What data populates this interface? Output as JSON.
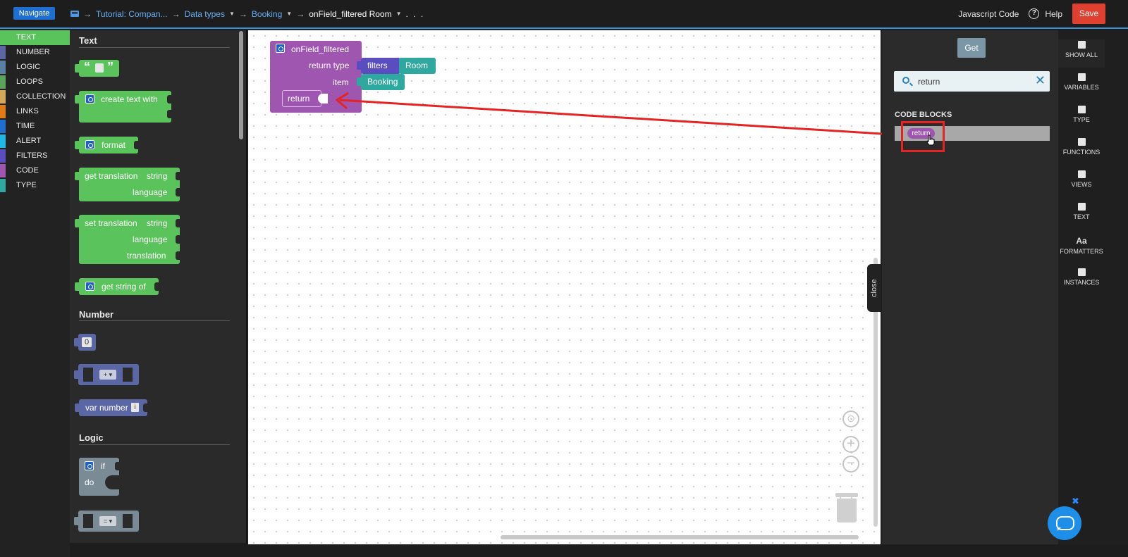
{
  "topbar": {
    "navigate_label": "Navigate",
    "breadcrumbs": [
      {
        "label": "Tutorial: Compan...",
        "dropdown": false
      },
      {
        "label": "Data types",
        "dropdown": true
      },
      {
        "label": "Booking",
        "dropdown": true
      },
      {
        "label": "onField_filtered Room",
        "dropdown": true
      }
    ],
    "more": ". . .",
    "js_code_label": "Javascript Code",
    "help_label": "Help",
    "save_label": "Save"
  },
  "categories": [
    {
      "label": "TEXT",
      "color": "#5bc35b",
      "active": true
    },
    {
      "label": "NUMBER",
      "color": "#5b67a5"
    },
    {
      "label": "LOGIC",
      "color": "#5b80a5"
    },
    {
      "label": "LOOPS",
      "color": "#5ba55b"
    },
    {
      "label": "COLLECTION",
      "color": "#d4a85a"
    },
    {
      "label": "LINKS",
      "color": "#e07b16"
    },
    {
      "label": "TIME",
      "color": "#1e6fd0"
    },
    {
      "label": "ALERT",
      "color": "#1eb8e8"
    },
    {
      "label": "FILTERS",
      "color": "#5a4dc0"
    },
    {
      "label": "CODE",
      "color": "#9e56b0"
    },
    {
      "label": "TYPE",
      "color": "#2fa8a0"
    }
  ],
  "flyout": {
    "sections": {
      "text": "Text",
      "number": "Number",
      "logic": "Logic"
    },
    "blocks": {
      "quote_open": "“",
      "quote_close": "”",
      "create_text_with": "create text with",
      "format": "format",
      "get_translation": "get translation",
      "set_translation": "set translation",
      "string": "string",
      "language": "language",
      "translation": "translation",
      "get_string_of": "get string of",
      "zero": "0",
      "plus_op": "+ ▾",
      "var_number": "var number",
      "info": "i",
      "if": "if",
      "do": "do",
      "eq_op": "= ▾"
    }
  },
  "workspace": {
    "event_block": {
      "title": "onField_filtered",
      "return_type_label": "return type",
      "item_label": "item",
      "filters": "filters",
      "room": "Room",
      "booking": "Booking",
      "return_label": "return"
    },
    "close_tab": "close",
    "controls": {
      "recenter": "⊙",
      "zoom_in": "+",
      "zoom_out": "−"
    }
  },
  "right_panel": {
    "get_label": "Get",
    "search": {
      "value": "return",
      "clear": "✕"
    },
    "code_blocks_title": "CODE BLOCKS",
    "result_label": "return"
  },
  "right_rail": [
    {
      "label": "SHOW ALL",
      "icon": "grid-icon",
      "active": true
    },
    {
      "label": "VARIABLES",
      "icon": "book-icon"
    },
    {
      "label": "TYPE",
      "icon": "database-icon"
    },
    {
      "label": "FUNCTIONS",
      "icon": "calculator-icon"
    },
    {
      "label": "VIEWS",
      "icon": "image-icon"
    },
    {
      "label": "TEXT",
      "icon": "document-icon"
    },
    {
      "label": "FORMATTERS",
      "icon": "formatters-icon",
      "glyph": "Aa"
    },
    {
      "label": "INSTANCES",
      "icon": "list-icon"
    }
  ],
  "chat": {
    "close": "✖"
  },
  "annotation_color": "#e42323"
}
